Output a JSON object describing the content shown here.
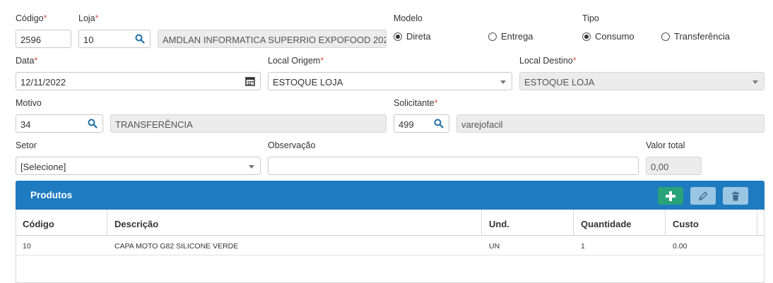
{
  "form": {
    "codigo": {
      "label": "Código",
      "required": "*",
      "value": "2596"
    },
    "loja": {
      "label": "Loja",
      "required": "*",
      "value": "10",
      "name": "AMDLAN INFORMATICA SUPERRIO EXPOFOOD 202"
    },
    "modelo": {
      "label": "Modelo",
      "options": [
        "Direta",
        "Entrega"
      ],
      "selected": "Direta"
    },
    "tipo": {
      "label": "Tipo",
      "options": [
        "Consumo",
        "Transferência"
      ],
      "selected": "Consumo"
    },
    "data": {
      "label": "Data",
      "required": "*",
      "value": "12/11/2022"
    },
    "local_origem": {
      "label": "Local Origem",
      "required": "*",
      "value": "ESTOQUE LOJA"
    },
    "local_destino": {
      "label": "Local Destino",
      "required": "*",
      "value": "ESTOQUE LOJA"
    },
    "motivo": {
      "label": "Motivo",
      "value": "34",
      "name": "TRANSFERÊNCIA"
    },
    "solicitante": {
      "label": "Solicitante",
      "required": "*",
      "value": "499",
      "name": "varejofacil"
    },
    "setor": {
      "label": "Setor",
      "value": "[Selecione]"
    },
    "observacao": {
      "label": "Observação",
      "value": ""
    },
    "valor_total": {
      "label": "Valor total",
      "value": "0,00"
    }
  },
  "produtos": {
    "title": "Produtos",
    "columns": [
      "Código",
      "Descrição",
      "Und.",
      "Quantidade",
      "Custo"
    ],
    "rows": [
      [
        "10",
        "CAPA MOTO G82 SILICONE VERDE",
        "UN",
        "1",
        "0.00"
      ]
    ]
  },
  "colors": {
    "header": "#1f7bbf",
    "add": "#28a37a",
    "required": "#d9534f"
  },
  "icons": [
    "search-icon",
    "calendar-icon",
    "plus-icon",
    "pencil-icon",
    "trash-icon"
  ]
}
